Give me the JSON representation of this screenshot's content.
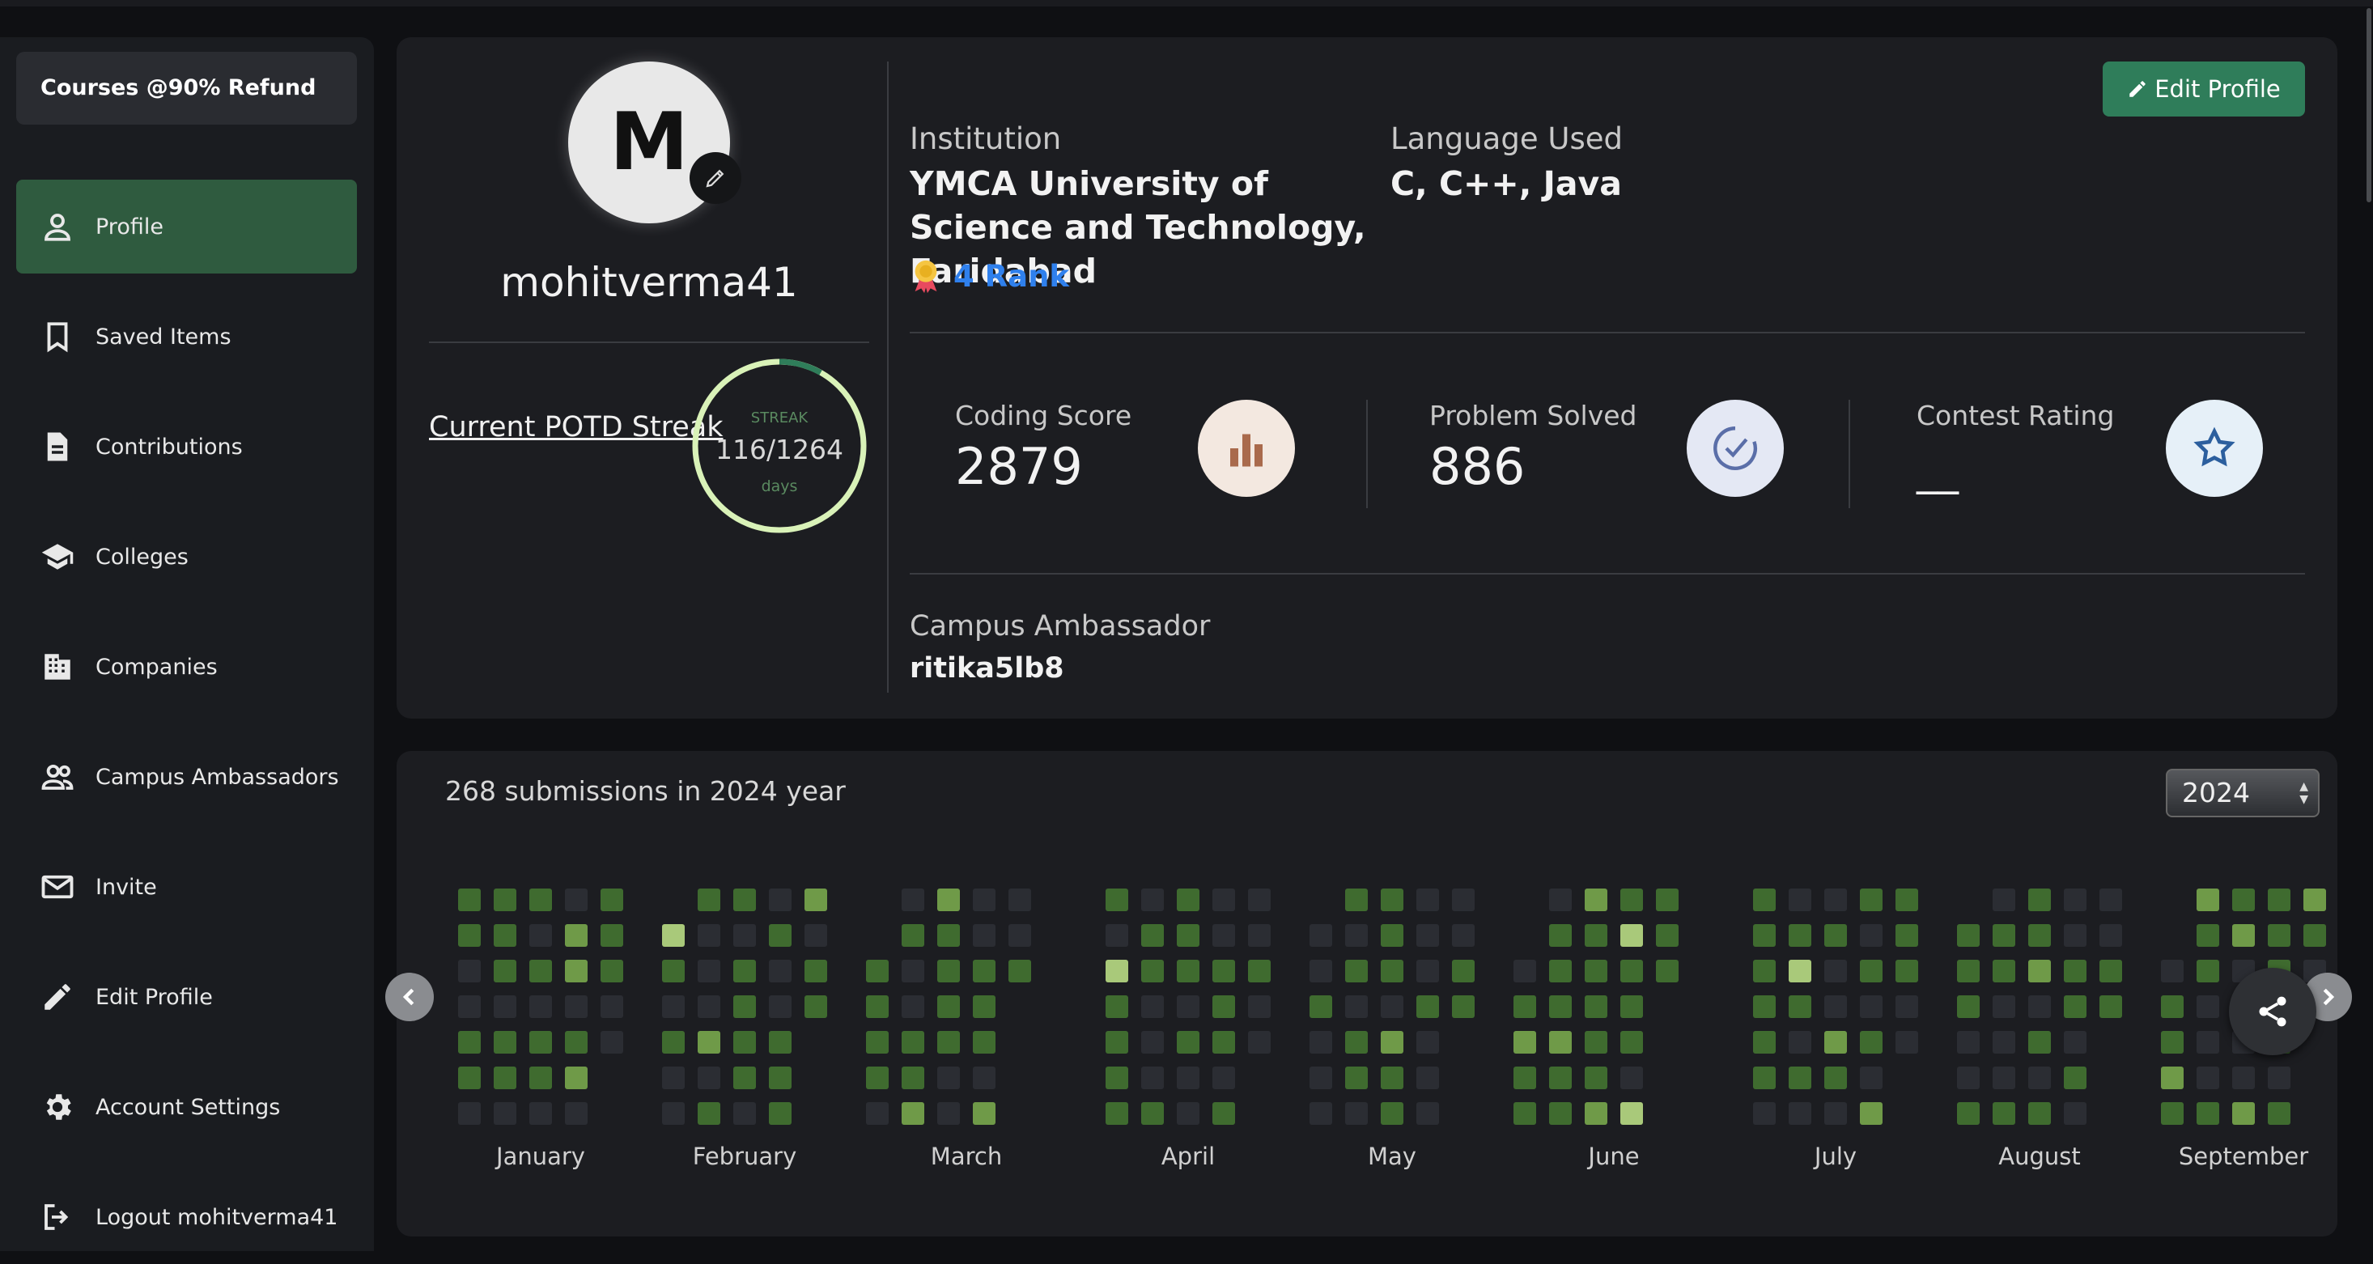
{
  "sidebar": {
    "promo": "Courses @90% Refund",
    "items": [
      {
        "label": "Profile",
        "icon": "person-icon"
      },
      {
        "label": "Saved Items",
        "icon": "bookmark-icon"
      },
      {
        "label": "Contributions",
        "icon": "document-icon"
      },
      {
        "label": "Colleges",
        "icon": "graduation-cap-icon"
      },
      {
        "label": "Companies",
        "icon": "building-icon"
      },
      {
        "label": "Campus Ambassadors",
        "icon": "people-icon"
      },
      {
        "label": "Invite",
        "icon": "mail-icon"
      },
      {
        "label": "Edit Profile",
        "icon": "pencil-icon"
      },
      {
        "label": "Account Settings",
        "icon": "gear-icon"
      },
      {
        "label": "Logout mohitverma41",
        "icon": "logout-icon"
      }
    ]
  },
  "profile": {
    "avatar_letter": "M",
    "username": "mohitverma41",
    "potd_label": "Current POTD Streak",
    "streak": {
      "label": "STREAK",
      "value": "116/1264",
      "unit": "days",
      "current": 116,
      "best": 1264
    },
    "institution_label": "Institution",
    "institution_value": "YMCA University of Science and Technology, Faridabad",
    "language_label": "Language Used",
    "language_value": "C, C++, Java",
    "rank": "4 Rank",
    "edit_button": "Edit Profile",
    "stats": [
      {
        "label": "Coding Score",
        "value": "2879",
        "icon": "bar-chart-icon"
      },
      {
        "label": "Problem Solved",
        "value": "886",
        "icon": "check-badge-icon"
      },
      {
        "label": "Contest Rating",
        "value": "__",
        "icon": "star-icon"
      }
    ],
    "ambassador_label": "Campus Ambassador",
    "ambassador_value": "ritika5lb8"
  },
  "submissions": {
    "title": "268 submissions in 2024 year",
    "year": "2024",
    "months": [
      "January",
      "February",
      "March",
      "April",
      "May",
      "June",
      "July",
      "August",
      "September"
    ]
  },
  "colors": {
    "accent": "#2f7d5a",
    "active_nav": "#2f5b3f",
    "rank_blue": "#2f80ed",
    "cell_empty": "#2b2d33",
    "cell_l1": "#3f6b2f",
    "cell_l2": "#6f9a48",
    "cell_l3": "#a9c97a"
  }
}
